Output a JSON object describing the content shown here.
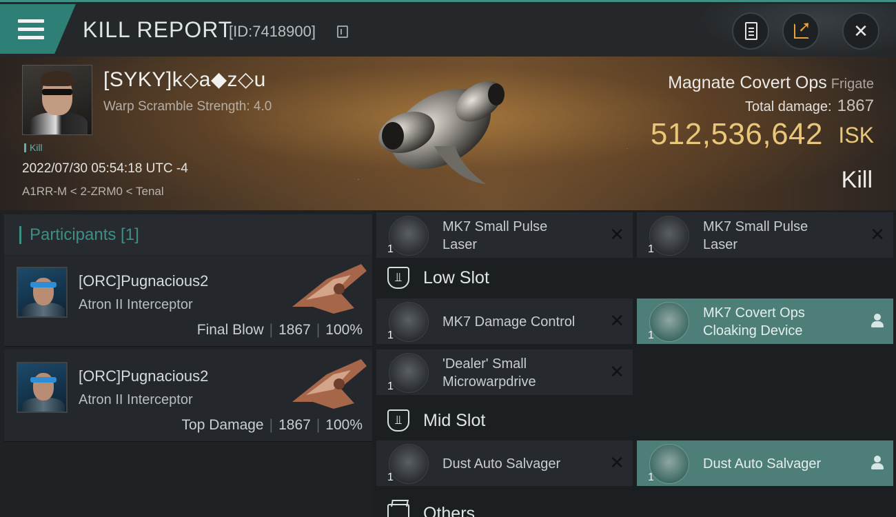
{
  "header": {
    "title": "KILL REPORT",
    "id_text": "[ID:7418900]",
    "icons": [
      "menu-icon",
      "copy-icon",
      "clipboard-icon",
      "share-icon",
      "close-icon"
    ]
  },
  "victim": {
    "name": "[SYKY]k◇a◆z◇u",
    "warp_scramble": "Warp Scramble Strength: 4.0",
    "kill_tag": "Kill",
    "datetime": "2022/07/30 05:54:18 UTC -4",
    "location": "A1RR-M < 2-ZRM0 < Tenal"
  },
  "ship": {
    "name": "Magnate Covert Ops",
    "class": "Frigate",
    "total_damage_label": "Total damage:",
    "total_damage": "1867",
    "isk_value": "512,536,642",
    "isk_unit": "ISK",
    "result": "Kill"
  },
  "participants": {
    "header": "Participants [1]",
    "rows": [
      {
        "name": "[ORC]Pugnacious2",
        "ship": "Atron II Interceptor",
        "role": "Final Blow",
        "damage": "1867",
        "percent": "100%"
      },
      {
        "name": "[ORC]Pugnacious2",
        "ship": "Atron II Interceptor",
        "role": "Top Damage",
        "damage": "1867",
        "percent": "100%"
      }
    ]
  },
  "fittings": {
    "high_slot_items": [
      {
        "name_line1": "MK7 Small Pulse",
        "name_line2": "Laser",
        "qty": "1",
        "status": "destroyed"
      },
      {
        "name_line1": "MK7 Small Pulse",
        "name_line2": "Laser",
        "qty": "1",
        "status": "destroyed"
      }
    ],
    "low_slot": {
      "label": "Low Slot",
      "items": [
        {
          "name": "MK7 Damage Control",
          "qty": "1",
          "status": "destroyed"
        },
        {
          "name_line1": "MK7 Covert Ops",
          "name_line2": "Cloaking Device",
          "qty": "1",
          "status": "dropped"
        },
        {
          "name_line1": "'Dealer' Small",
          "name_line2": "Microwarpdrive",
          "qty": "1",
          "status": "destroyed"
        }
      ]
    },
    "mid_slot": {
      "label": "Mid Slot",
      "items": [
        {
          "name": "Dust Auto Salvager",
          "qty": "1",
          "status": "destroyed"
        },
        {
          "name": "Dust Auto Salvager",
          "qty": "1",
          "status": "dropped"
        }
      ]
    },
    "others": {
      "label": "Others"
    }
  },
  "colors": {
    "accent_teal": "#2e7f75",
    "isk_gold": "#e9c77a",
    "dropped_bg": "#4e7e78"
  }
}
